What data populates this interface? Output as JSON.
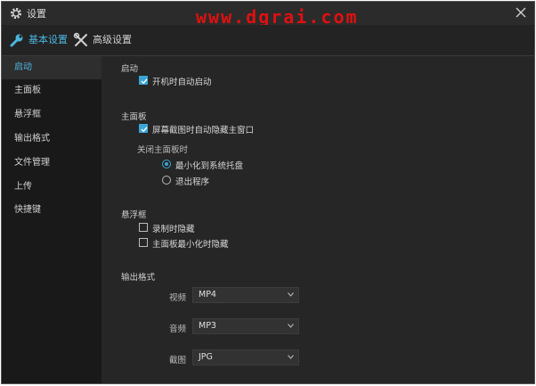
{
  "window": {
    "title": "设置",
    "watermark": "www.dgrai.com"
  },
  "tabs": [
    {
      "label": "基本设置",
      "icon": "wrench-icon",
      "active": true
    },
    {
      "label": "高级设置",
      "icon": "tools-icon",
      "active": false
    }
  ],
  "sidebar": {
    "items": [
      {
        "label": "启动"
      },
      {
        "label": "主面板"
      },
      {
        "label": "悬浮框"
      },
      {
        "label": "输出格式"
      },
      {
        "label": "文件管理"
      },
      {
        "label": "上传"
      },
      {
        "label": "快捷键"
      }
    ]
  },
  "startup": {
    "title": "启动",
    "autostart": {
      "label": "开机时自动启动",
      "checked": true
    }
  },
  "mainpanel": {
    "title": "主面板",
    "hide_on_capture": {
      "label": "屏幕截图时自动隐藏主窗口",
      "checked": true
    },
    "close_label": "关闭主面板时",
    "minimize_tray": {
      "label": "最小化到系统托盘",
      "selected": true
    },
    "exit_program": {
      "label": "退出程序",
      "selected": false
    }
  },
  "floating": {
    "title": "悬浮框",
    "hide_on_record": {
      "label": "录制时隐藏",
      "checked": false
    },
    "hide_on_minimize": {
      "label": "主面板最小化时隐藏",
      "checked": false
    }
  },
  "output": {
    "title": "输出格式",
    "video": {
      "label": "视频",
      "value": "MP4"
    },
    "audio": {
      "label": "音频",
      "value": "MP3"
    },
    "screenshot": {
      "label": "截图",
      "value": "JPG"
    }
  },
  "colors": {
    "accent": "#3ba5d6",
    "watermark": "#e01010"
  }
}
